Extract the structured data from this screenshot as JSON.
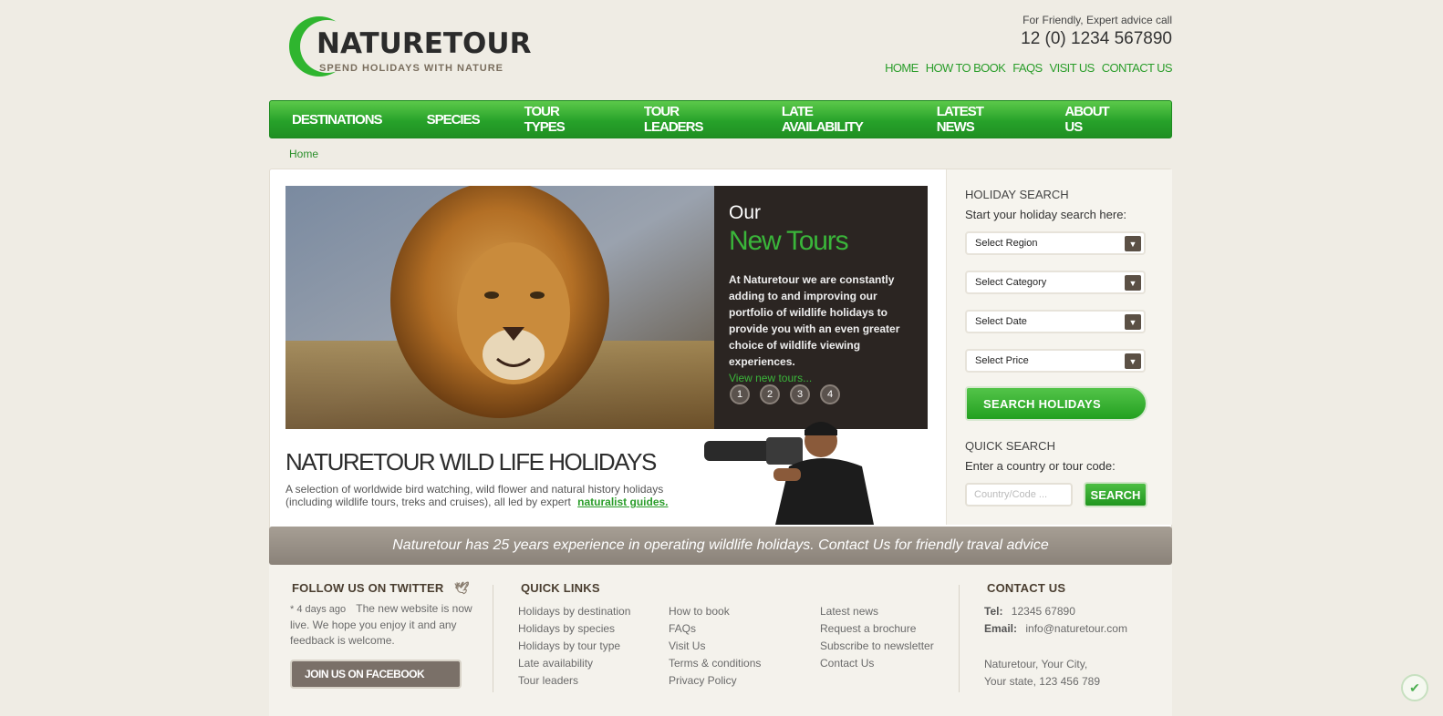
{
  "header": {
    "logo_name": "NATURETOUR",
    "logo_tagline": "SPEND HOLIDAYS WITH NATURE",
    "advice_text": "For Friendly, Expert advice call",
    "phone": "12 (0) 1234 567890",
    "toplinks": [
      "HOME",
      "HOW TO BOOK",
      "FAQS",
      "VISIT US",
      "CONTACT US"
    ]
  },
  "mainnav": [
    "DESTINATIONS",
    "SPECIES",
    "TOUR TYPES",
    "TOUR LEADERS",
    "LATE AVAILABILITY",
    "LATEST NEWS",
    "ABOUT US"
  ],
  "breadcrumb": "Home",
  "slider": {
    "our": "Our",
    "new_tours": "New Tours",
    "text": "At Naturetour we are constantly adding to and improving our portfolio of wildlife holidays to provide you with an even greater choice of wildlife viewing experiences.",
    "link": "View new tours...",
    "dots": [
      "1",
      "2",
      "3",
      "4"
    ]
  },
  "main": {
    "headline": "NATURETOUR WILD LIFE HOLIDAYS",
    "intro": "A selection of worldwide bird watching, wild flower and natural history holidays (including wildlife tours, treks and cruises), all led by expert",
    "intro_link": "naturalist guides."
  },
  "sidebar": {
    "holiday_title": "HOLIDAY SEARCH",
    "holiday_sub": "Start your holiday search here:",
    "selects": [
      "Select Region",
      "Select Category",
      "Select Date",
      "Select Price"
    ],
    "search_button": "SEARCH HOLIDAYS",
    "quick_title": "QUICK SEARCH",
    "quick_sub": "Enter a country or tour code:",
    "quick_placeholder": "Country/Code ...",
    "quick_button": "SEARCH"
  },
  "banner": "Naturetour has 25 years experience in operating wildlife holidays. Contact Us for friendly traval advice",
  "footer": {
    "twitter_title": "FOLLOW US ON TWITTER",
    "tweet_time": "* 4 days ago",
    "tweet_text": "The new website is now live. We hope you enjoy it and any feedback is welcome.",
    "facebook_button": "JOIN US ON FACEBOOK",
    "quick_links_title": "QUICK LINKS",
    "links_col1": [
      "Holidays by destination",
      "Holidays by species",
      "Holidays by tour type",
      "Late availability",
      "Tour leaders"
    ],
    "links_col2": [
      "How to book",
      "FAQs",
      "Visit Us",
      "Terms & conditions",
      "Privacy Policy"
    ],
    "links_col3": [
      "Latest news",
      "Request a brochure",
      "Subscribe to newsletter",
      "Contact Us"
    ],
    "contact_title": "CONTACT US",
    "tel_label": "Tel:",
    "tel": "12345 67890",
    "email_label": "Email:",
    "email": "info@naturetour.com",
    "address_line1": "Naturetour, Your City,",
    "address_line2": "Your state, 123 456 789"
  },
  "icons": {
    "dropdown": "chevron-down-icon",
    "twitter": "bird-icon",
    "security": "shield-check-icon"
  },
  "colors": {
    "brand_green": "#2a9d2a",
    "panel_dark": "#2b2522",
    "banner_gray": "#8a8279"
  }
}
